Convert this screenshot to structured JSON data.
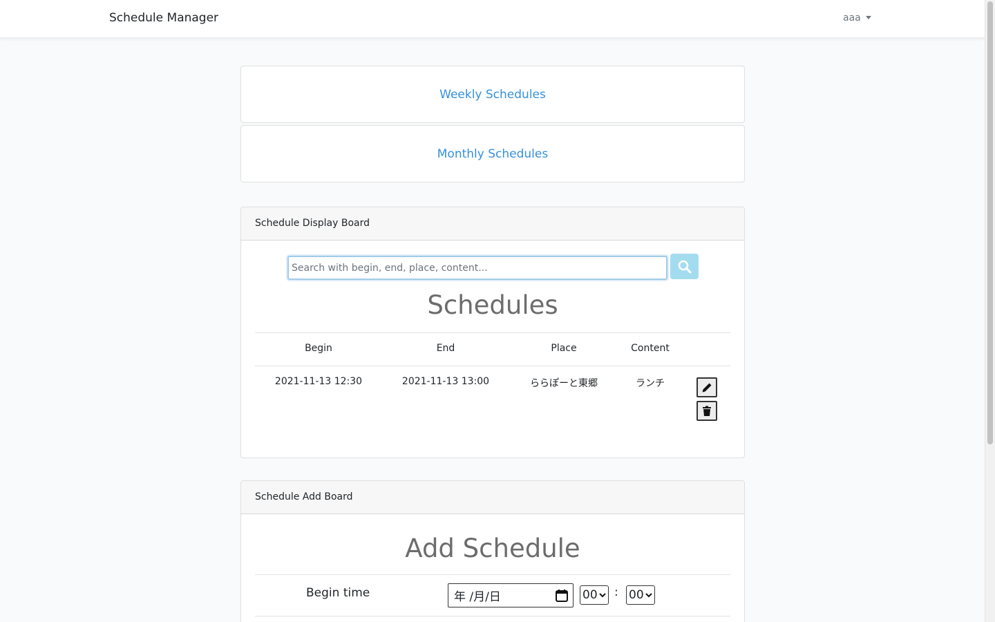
{
  "navbar": {
    "brand": "Schedule Manager",
    "user": "aaa"
  },
  "links": {
    "weekly": "Weekly Schedules",
    "monthly": "Monthly Schedules"
  },
  "display_board": {
    "header": "Schedule Display Board",
    "search_placeholder": "Search with begin, end, place, content...",
    "title": "Schedules",
    "columns": [
      "Begin",
      "End",
      "Place",
      "Content"
    ],
    "rows": [
      {
        "begin": "2021-11-13 12:30",
        "end": "2021-11-13 13:00",
        "place": "ららぽーと東郷",
        "content": "ランチ"
      }
    ]
  },
  "add_board": {
    "header": "Schedule Add Board",
    "title": "Add Schedule",
    "begin_label": "Begin time",
    "date_placeholder": "年 /月/日",
    "hour": "00",
    "separator": ":",
    "minute": "00"
  },
  "colors": {
    "link": "#3490dc",
    "search_button": "#a4dcef",
    "header_bg": "#f7f7f7",
    "page_bg": "#f8fafc"
  },
  "icons": [
    "search-icon",
    "pencil-icon",
    "trash-icon",
    "calendar-icon",
    "chevron-down-icon",
    "caret-down-icon"
  ]
}
